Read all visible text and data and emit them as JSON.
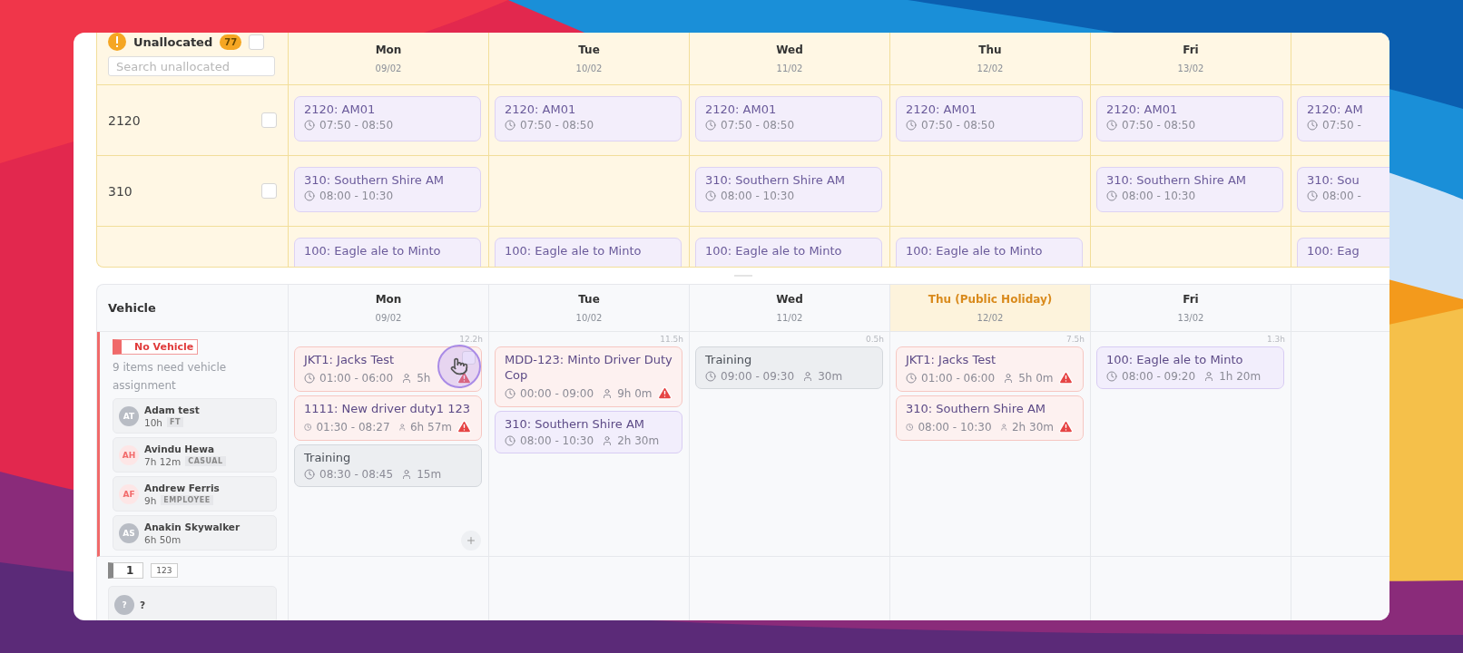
{
  "unallocated": {
    "title": "Unallocated",
    "count": "77",
    "checked": false,
    "search": {
      "placeholder": "Search unallocated"
    },
    "days": [
      {
        "day": "Mon",
        "date": "09/02"
      },
      {
        "day": "Tue",
        "date": "10/02"
      },
      {
        "day": "Wed",
        "date": "11/02"
      },
      {
        "day": "Thu",
        "date": "12/02"
      },
      {
        "day": "Fri",
        "date": "13/02"
      }
    ],
    "rows": [
      {
        "label": "2120",
        "checked": false,
        "cells": [
          {
            "title": "2120: AM01",
            "time": "07:50 - 08:50"
          },
          {
            "title": "2120: AM01",
            "time": "07:50 - 08:50"
          },
          {
            "title": "2120: AM01",
            "time": "07:50 - 08:50"
          },
          {
            "title": "2120: AM01",
            "time": "07:50 - 08:50"
          },
          {
            "title": "2120: AM01",
            "time": "07:50 - 08:50"
          },
          {
            "title": "2120: AM",
            "time": "07:50 -"
          }
        ]
      },
      {
        "label": "310",
        "checked": false,
        "cells": [
          {
            "title": "310: Southern Shire AM",
            "time": "08:00 - 10:30"
          },
          null,
          {
            "title": "310: Southern Shire AM",
            "time": "08:00 - 10:30"
          },
          null,
          {
            "title": "310: Southern Shire AM",
            "time": "08:00 - 10:30"
          },
          {
            "title": "310: Sou",
            "time": "08:00 -"
          }
        ]
      },
      {
        "cells": [
          {
            "title": "100: Eagle ale to Minto"
          },
          {
            "title": "100: Eagle ale to Minto"
          },
          {
            "title": "100: Eagle ale to Minto"
          },
          {
            "title": "100: Eagle ale to Minto"
          },
          null,
          {
            "title": "100: Eag"
          }
        ]
      }
    ]
  },
  "vehicles": {
    "heading": "Vehicle",
    "days": [
      {
        "day": "Mon",
        "date": "09/02",
        "holiday": false
      },
      {
        "day": "Tue",
        "date": "10/02",
        "holiday": false
      },
      {
        "day": "Wed",
        "date": "11/02",
        "holiday": false
      },
      {
        "day": "Thu (Public Holiday)",
        "date": "12/02",
        "holiday": true
      },
      {
        "day": "Fri",
        "date": "13/02",
        "holiday": false
      }
    ],
    "groups": [
      {
        "badge": "No Vehicle",
        "note": "9 items need vehicle assignment",
        "drivers": [
          {
            "initials": "AT",
            "name": "Adam test",
            "hours": "10h",
            "tag": "FT",
            "color": "#b8bcc4"
          },
          {
            "initials": "AH",
            "name": "Avindu Hewa",
            "hours": "7h 12m",
            "tag": "CASUAL",
            "color": "#f26b6b"
          },
          {
            "initials": "AF",
            "name": "Andrew Ferris",
            "hours": "9h",
            "tag": "EMPLOYEE",
            "color": "#f26b6b"
          },
          {
            "initials": "AS",
            "name": "Anakin Skywalker",
            "hours": "6h 50m",
            "color": "#b8bcc4"
          }
        ],
        "cells": [
          {
            "total": "12.2h",
            "add_button": true,
            "shifts": [
              {
                "kind": "warning",
                "title": "JKT1: Jacks Test",
                "time": "01:00 - 06:00",
                "duration": "5h",
                "alert": true,
                "hovered": true
              },
              {
                "kind": "warning",
                "title": "1111: New driver duty1 123",
                "time": "01:30 - 08:27",
                "duration": "6h 57m",
                "alert": true,
                "hovered": false
              },
              {
                "kind": "training",
                "title": "Training",
                "time": "08:30 - 08:45",
                "duration": "15m",
                "alert": false,
                "hovered": false
              }
            ]
          },
          {
            "total": "11.5h",
            "add_button": false,
            "shifts": [
              {
                "kind": "warning",
                "title": "MDD-123: Minto Driver Duty Cop",
                "time": "00:00 - 09:00",
                "duration": "9h 0m",
                "alert": true,
                "hovered": false
              },
              {
                "kind": "allocated",
                "title": "310: Southern Shire AM",
                "time": "08:00 - 10:30",
                "duration": "2h 30m",
                "alert": false,
                "hovered": false
              }
            ]
          },
          {
            "total": "0.5h",
            "add_button": false,
            "shifts": [
              {
                "kind": "training",
                "title": "Training",
                "time": "09:00 - 09:30",
                "duration": "30m",
                "alert": false,
                "hovered": false
              }
            ]
          },
          {
            "total": "7.5h",
            "add_button": false,
            "shifts": [
              {
                "kind": "warning",
                "title": "JKT1: Jacks Test",
                "time": "01:00 - 06:00",
                "duration": "5h 0m",
                "alert": true,
                "hovered": false
              },
              {
                "kind": "warning",
                "title": "310: Southern Shire AM",
                "time": "08:00 - 10:30",
                "duration": "2h 30m",
                "alert": true,
                "hovered": false
              }
            ]
          },
          {
            "total": "1.3h",
            "add_button": false,
            "shifts": [
              {
                "kind": "allocated",
                "title": "100: Eagle ale to Minto",
                "time": "08:00 - 09:20",
                "duration": "1h 20m",
                "alert": false,
                "hovered": false
              }
            ]
          }
        ]
      },
      {
        "number": "1",
        "code": "123",
        "drivers": [
          {
            "initials": "?",
            "name": "?",
            "color": "#b8bcc4"
          }
        ]
      }
    ]
  }
}
